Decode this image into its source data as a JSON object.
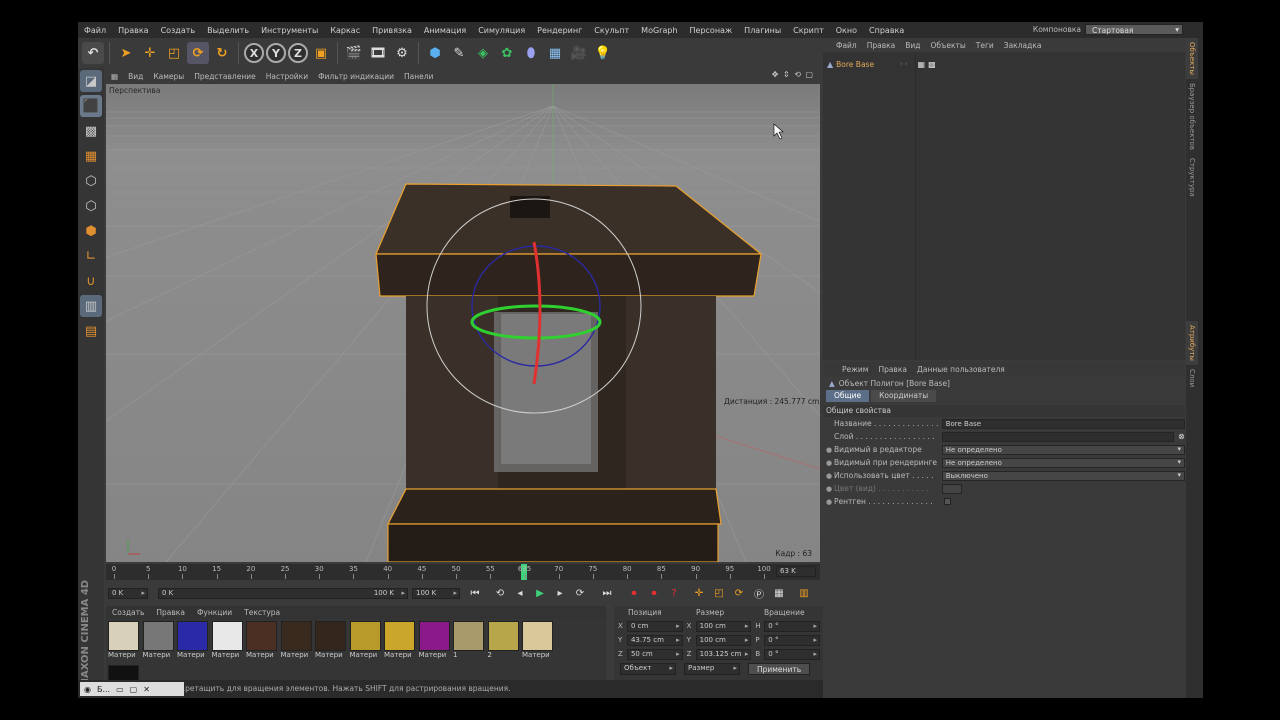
{
  "menubar": {
    "items": [
      "Файл",
      "Правка",
      "Создать",
      "Выделить",
      "Инструменты",
      "Каркас",
      "Привязка",
      "Анимация",
      "Симуляция",
      "Рендеринг",
      "Скульпт",
      "MoGraph",
      "Персонаж",
      "Плагины",
      "Скрипт",
      "Окно",
      "Справка"
    ],
    "layout_label": "Компоновка",
    "layout_value": "Стартовая"
  },
  "viewport": {
    "menu": [
      "Вид",
      "Камеры",
      "Представление",
      "Настройки",
      "Фильтр индикации",
      "Панели"
    ],
    "label": "Перспектива",
    "distance": "Дистанция : 245.777 cm",
    "frame": "Кадр : 63"
  },
  "timeline": {
    "ticks": [
      "0",
      "5",
      "10",
      "15",
      "20",
      "25",
      "30",
      "35",
      "40",
      "45",
      "50",
      "55",
      "635",
      "70",
      "75",
      "80",
      "85",
      "90",
      "95",
      "100"
    ],
    "current": 63,
    "end_field": "63 K"
  },
  "transport": {
    "start_field": "0 K",
    "range_start": "0 K",
    "range_end": "100 K",
    "end_field": "100 K"
  },
  "materials": {
    "menu": [
      "Создать",
      "Правка",
      "Функции",
      "Текстура"
    ],
    "items": [
      {
        "name": "Матери",
        "color": "#d8d0b8"
      },
      {
        "name": "Матери",
        "color": "#777"
      },
      {
        "name": "Матери",
        "color": "#2a2aa8"
      },
      {
        "name": "Матери",
        "color": "#e8e8e8"
      },
      {
        "name": "Матери",
        "color": "#4a2f22"
      },
      {
        "name": "Матери",
        "color": "#3a2a1e"
      },
      {
        "name": "Матери",
        "color": "#33271d"
      },
      {
        "name": "Матери",
        "color": "#b89a2a"
      },
      {
        "name": "Матери",
        "color": "#caa62a"
      },
      {
        "name": "Матери",
        "color": "#8a1a8a"
      },
      {
        "name": "1",
        "color": "#a89a6a"
      },
      {
        "name": "2",
        "color": "#b8a64a"
      },
      {
        "name": "Матери",
        "color": "#d8c89a"
      },
      {
        "name": "Матери",
        "color": "#111"
      }
    ],
    "brand": "MAXON CINEMA 4D"
  },
  "coords": {
    "headers": [
      "Позиция",
      "Размер",
      "Вращение"
    ],
    "rows": [
      {
        "pl": "X",
        "pv": "0 cm",
        "sl": "X",
        "sv": "100 cm",
        "rl": "H",
        "rv": "0 °"
      },
      {
        "pl": "Y",
        "pv": "43.75 cm",
        "sl": "Y",
        "sv": "100 cm",
        "rl": "P",
        "rv": "0 °"
      },
      {
        "pl": "Z",
        "pv": "50 cm",
        "sl": "Z",
        "sv": "103.125 cm",
        "rl": "B",
        "rv": "0 °"
      }
    ],
    "mode1": "Объект",
    "mode2": "Размер",
    "apply": "Применить"
  },
  "status": "...ретащить для вращения элементов. Нажать SHIFT для растрирования вращения.",
  "object_manager": {
    "menu": [
      "Файл",
      "Правка",
      "Вид",
      "Объекты",
      "Теги",
      "Закладка"
    ],
    "object_name": "Bore Base"
  },
  "side_tabs": [
    "Объекты",
    "Браузер объектов",
    "Структура"
  ],
  "side_tabs_bottom": [
    "Атрибуты",
    "Слои"
  ],
  "attributes": {
    "menu": [
      "Режим",
      "Правка",
      "Данные пользователя"
    ],
    "title": "Объект Полигон [Bore Base]",
    "tabs": [
      "Общие",
      "Координаты"
    ],
    "section": "Общие свойства",
    "name_label": "Название . . . . . . . . . . . . . .",
    "name_value": "Bore Base",
    "layer_label": "Слой . . . . . . . . . . . . . . . . .",
    "vis_editor_label": "Видимый в редакторе",
    "vis_editor_value": "Не определено",
    "vis_render_label": "Видимый при рендеринге",
    "vis_render_value": "Не определено",
    "use_color_label": "Использовать цвет . . . . .",
    "use_color_value": "Выключено",
    "color_label": "Цвет (вид) . . . . . . . . . . .",
    "xray_label": "Рентген . . . . . . . . . . . . . ."
  },
  "mini_window": "Б..."
}
